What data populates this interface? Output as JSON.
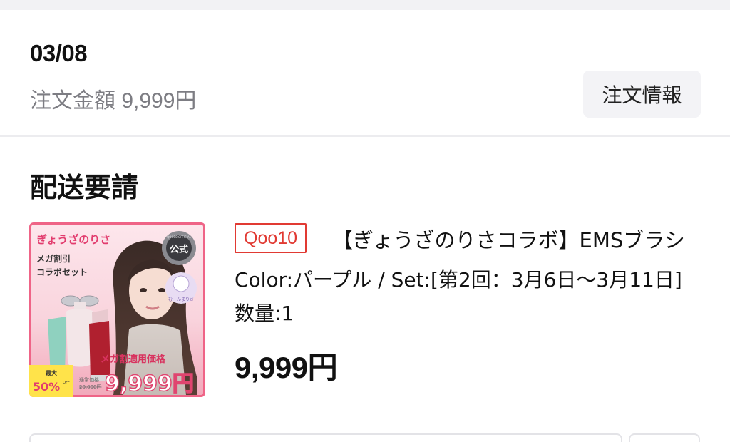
{
  "order": {
    "date": "03/08",
    "amount_text": "注文金額 9,999円",
    "info_button_label": "注文情報"
  },
  "section": {
    "title": "配送要請"
  },
  "product": {
    "store_badge": "Qoo10",
    "name": "【ぎょうざのりさコラボ】EMSブラシ",
    "option": "Color:パープル / Set:[第2回：3月6日〜3月11日]",
    "quantity": "数量:1",
    "price": "9,999円",
    "image": {
      "brand_text": "ぎょうざのりさ",
      "promo_line1": "メガ割引",
      "promo_line2": "コラボセット",
      "official_seal": "公式",
      "seal_ring_text": "QOO10 OFFICIAL",
      "sticker_text": "むーんまりさ",
      "mega_price_label": "メガ割適用価格",
      "max_label": "最大",
      "discount": "50%",
      "off_label": "OFF",
      "regular_price_label": "通常価格",
      "regular_price": "20,000円",
      "sale_price": "9,999円"
    }
  },
  "colors": {
    "accent_red": "#e13a33",
    "image_pink": "#f06a88",
    "muted_text": "#7d7d83",
    "button_bg": "#f3f3f6"
  }
}
